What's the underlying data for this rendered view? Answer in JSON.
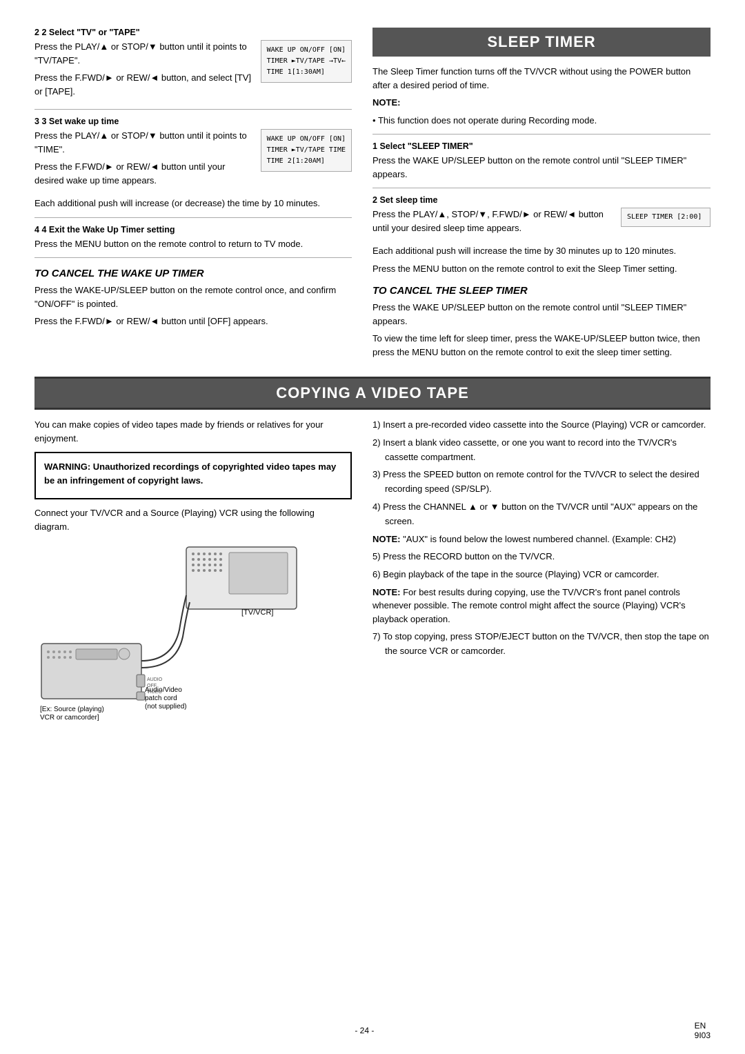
{
  "page": {
    "page_number": "- 24 -",
    "footer_code": "EN\n9I03"
  },
  "sleep_timer": {
    "title": "SLEEP TIMER",
    "intro": "The Sleep Timer function turns off the TV/VCR without using the POWER button after a desired period of time.",
    "note_label": "NOTE:",
    "note_text": "This function does not operate during Recording mode.",
    "step1": {
      "header": "1  Select \"SLEEP TIMER\"",
      "text": "Press the WAKE UP/SLEEP button on the remote control until \"SLEEP TIMER\" appears."
    },
    "step2": {
      "header": "2  Set sleep time",
      "text1": "Press the PLAY/▲, STOP/▼, F.FWD/► or REW/◄ button until your desired sleep time appears.",
      "text2": "Each additional push will increase the time by 30 minutes up to 120 minutes.",
      "text3": "Press the MENU button on the remote control to exit the Sleep Timer setting.",
      "lcd": "SLEEP TIMER  [2:00]"
    },
    "cancel_title": "TO CANCEL THE SLEEP TIMER",
    "cancel_text1": "Press the WAKE UP/SLEEP button on the remote control until \"SLEEP TIMER\" appears.",
    "cancel_text2": "To view the time left for sleep timer, press the WAKE-UP/SLEEP button twice, then press the MENU button on the remote control to exit the sleep timer setting."
  },
  "left_column": {
    "step2": {
      "header": "2  Select \"TV\" or \"TAPE\"",
      "text1": "Press the PLAY/▲ or STOP/▼ button until it points to \"TV/TAPE\".",
      "text2": "Press the F.FWD/► or REW/◄ button, and select [TV] or [TAPE].",
      "lcd": {
        "line1": "WAKE UP   ON/OFF  [ON]",
        "line2": "TIMER    ►TV/TAPE  →TV←",
        "line3": "              TIME    1[1:30AM]"
      }
    },
    "step3": {
      "header": "3  Set wake up time",
      "text1": "Press the PLAY/▲ or STOP/▼ button until it points to \"TIME\".",
      "text2": "Press the F.FWD/► or REW/◄ button until your desired wake up time appears.",
      "text3": "Each additional push will increase (or decrease) the time by 10 minutes.",
      "lcd": {
        "line1": "WAKE UP   ON/OFF  [ON]",
        "line2": "TIMER    ►TV/TAPE   TIME",
        "line3": "              TIME   2[1:20AM]"
      }
    },
    "step4": {
      "header": "4  Exit the Wake Up Timer setting",
      "text": "Press the MENU button on the remote control to return to TV mode."
    },
    "cancel_title": "TO CANCEL THE WAKE UP TIMER",
    "cancel_text1": "Press the WAKE-UP/SLEEP button on the remote control once, and confirm \"ON/OFF\" is pointed.",
    "cancel_text2": "Press the F.FWD/► or REW/◄ button until [OFF] appears."
  },
  "copying": {
    "title": "COPYING A VIDEO TAPE",
    "intro": "You can make copies of video tapes made by friends or relatives for your enjoyment.",
    "warning_title": "WARNING: Unauthorized recordings of copyrighted video tapes may be an infringement of copyright laws.",
    "connect_text": "Connect your TV/VCR and a Source (Playing) VCR using the following diagram.",
    "diagram_labels": {
      "tvvcr": "[TV/VCR]",
      "source": "[Ex: Source (playing)\nVCR or camcorder]",
      "patch_cord": "Audio/Video\npatch cord\n(not supplied)"
    },
    "steps": [
      "Insert a pre-recorded video cassette into the Source (Playing) VCR or camcorder.",
      "Insert a blank video cassette, or one you want to record into the TV/VCR's cassette compartment.",
      "Press the SPEED button on remote control for the TV/VCR to select the desired recording speed (SP/SLP).",
      "Press the CHANNEL ▲ or ▼ button on the TV/VCR until \"AUX\" appears on the screen.",
      "Press the RECORD button on the TV/VCR.",
      "Begin playback of the tape in the source (Playing) VCR or camcorder.",
      "To stop copying, press STOP/EJECT button on the TV/VCR, then stop the tape on the source VCR or camcorder."
    ],
    "notes": [
      "\"AUX\" is found below the lowest numbered channel. (Example: CH2)",
      "For best results during copying, use the TV/VCR's front panel controls whenever possible. The remote control might affect the source (Playing) VCR's playback operation."
    ]
  }
}
